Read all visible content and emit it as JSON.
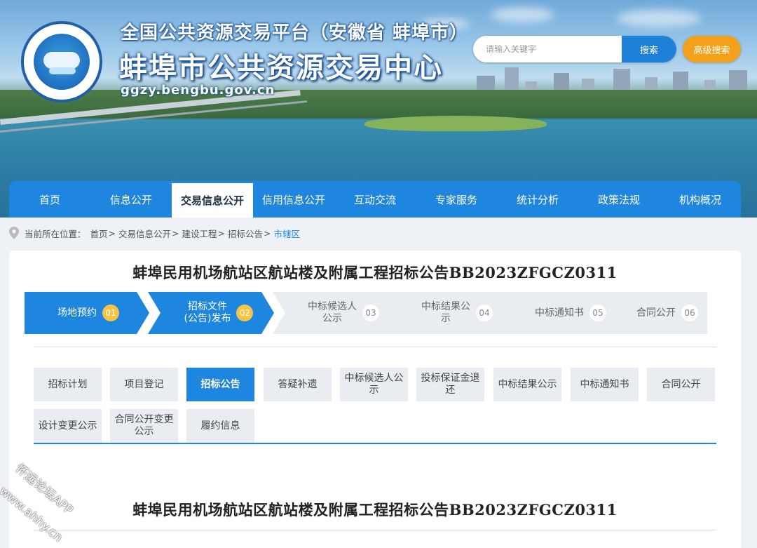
{
  "header": {
    "platform_subtitle": "全国公共资源交易平台（安徽省 蚌埠市）",
    "center_name": "蚌埠市公共资源交易中心",
    "site_url": "ggzy.bengbu.gov.cn",
    "search": {
      "placeholder": "请输入关键字",
      "button_label": "搜索",
      "advanced_label": "高级搜索"
    }
  },
  "nav": {
    "items": [
      {
        "label": "首页"
      },
      {
        "label": "信息公开"
      },
      {
        "label": "交易信息公开",
        "active": true
      },
      {
        "label": "信用信息公开"
      },
      {
        "label": "互动交流"
      },
      {
        "label": "专家服务"
      },
      {
        "label": "统计分析"
      },
      {
        "label": "政策法规"
      },
      {
        "label": "机构概况"
      }
    ]
  },
  "breadcrumb": {
    "prefix": "当前所在位置：",
    "items": [
      "首页",
      "交易信息公开",
      "建设工程",
      "招标公告"
    ],
    "separator": ">",
    "current": "市辖区"
  },
  "notice": {
    "title": "蚌埠民用机场航站区航站楼及附属工程招标公告BB2023ZFGCZ0311"
  },
  "steps": [
    {
      "label": "场地预约",
      "num": "01",
      "active": true
    },
    {
      "label": "招标文件\n(公告)发布",
      "num": "02",
      "active": true
    },
    {
      "label": "中标候选人\n公示",
      "num": "03",
      "active": false
    },
    {
      "label": "中标结果公\n示",
      "num": "04",
      "active": false
    },
    {
      "label": "中标通知书",
      "num": "05",
      "active": false
    },
    {
      "label": "合同公开",
      "num": "06",
      "active": false
    }
  ],
  "tabs": [
    {
      "label": "招标计划"
    },
    {
      "label": "项目登记"
    },
    {
      "label": "招标公告",
      "active": true
    },
    {
      "label": "答疑补遗"
    },
    {
      "label": "中标候选人公示"
    },
    {
      "label": "投标保证金退还"
    },
    {
      "label": "中标结果公示"
    },
    {
      "label": "中标通知书"
    },
    {
      "label": "合同公开"
    },
    {
      "label": "设计变更公示"
    },
    {
      "label": "合同公开变更公示"
    },
    {
      "label": "履约信息"
    }
  ],
  "watermark": {
    "line1": "怀远论坛APP",
    "line2": "www.ahhy.cn"
  },
  "colors": {
    "primary": "#1f86e0",
    "accent": "#f3a11a",
    "step_badge": "#f6c342"
  }
}
